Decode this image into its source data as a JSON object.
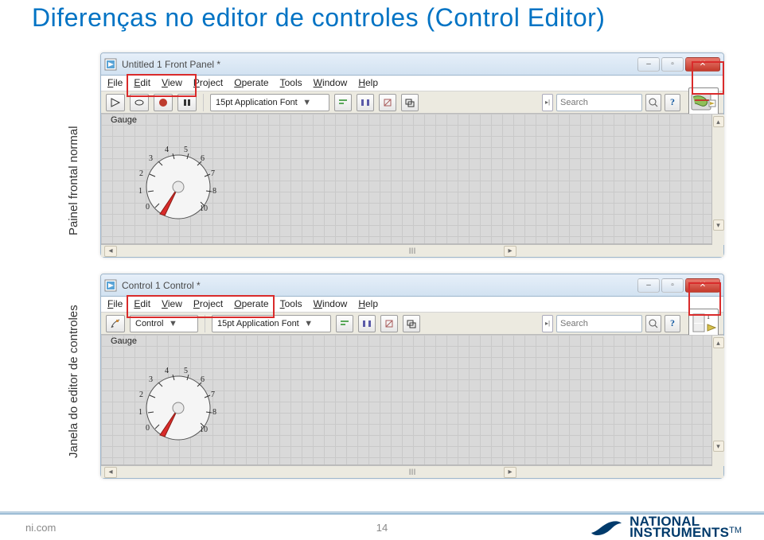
{
  "slide": {
    "title": "Diferenças no editor de controles (Control Editor)"
  },
  "labels": {
    "panelA": "Painel frontal normal",
    "panelB": "Janela do editor de controles"
  },
  "windowA": {
    "title": "Untitled 1 Front Panel *",
    "menu": {
      "file": "File",
      "edit": "Edit",
      "view": "View",
      "project": "Project",
      "operate": "Operate",
      "tools": "Tools",
      "window": "Window",
      "help": "Help"
    },
    "toolbar": {
      "font": "15pt Application Font",
      "search_placeholder": "Search"
    },
    "gauge_label": "Gauge",
    "gauge_ticks": [
      "0",
      "1",
      "2",
      "3",
      "4",
      "5",
      "6",
      "7",
      "8",
      "10"
    ]
  },
  "windowB": {
    "title": "Control 1 Control *",
    "menu": {
      "file": "File",
      "edit": "Edit",
      "view": "View",
      "project": "Project",
      "operate": "Operate",
      "tools": "Tools",
      "window": "Window",
      "help": "Help"
    },
    "toolbar": {
      "type": "Control",
      "font": "15pt Application Font",
      "search_placeholder": "Search"
    },
    "gauge_label": "Gauge",
    "gauge_ticks": [
      "0",
      "1",
      "2",
      "3",
      "4",
      "5",
      "6",
      "7",
      "8",
      "10"
    ]
  },
  "footer": {
    "site": "ni.com",
    "page": "14",
    "brand_top": "NATIONAL",
    "brand_bottom": "INSTRUMENTS",
    "tm": "TM"
  }
}
